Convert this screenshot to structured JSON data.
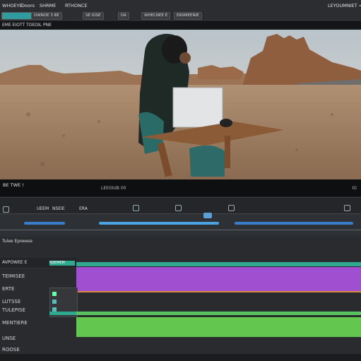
{
  "menubar": {
    "items": [
      "WHOEYE",
      "Doors",
      "SHRME",
      "RTHONCE"
    ],
    "buttons": [
      "DWNOE 3 BE",
      "SE IOSE",
      "DA",
      "WHECNEE E",
      "ERSMEENIE",
      "LEYOUMNIET ="
    ]
  },
  "viewer": {
    "title": "EME EIOTT TOEOIL PNE",
    "caption": "BE TWE !",
    "timecode": "LEEOIUB 00",
    "zoom": "IO"
  },
  "timeline": {
    "toolbar": [
      "UEEM",
      "NSEIE",
      "ERA"
    ],
    "tracks": {
      "label_top": "Tulee Epoeese",
      "track1_name": "AVPOWEE E",
      "clip1_name": "NSEMEM",
      "rows": [
        "TEIMISEE",
        "ERTE",
        "LUTSSE",
        "TULEPISE",
        "MENTIERE",
        "UNSE",
        "ROOSE"
      ]
    }
  },
  "colors": {
    "accent_blue": "#3a7ec9",
    "clip_purple": "#a04fd0",
    "clip_green": "#63c74f",
    "track_teal": "#2fa98f"
  }
}
